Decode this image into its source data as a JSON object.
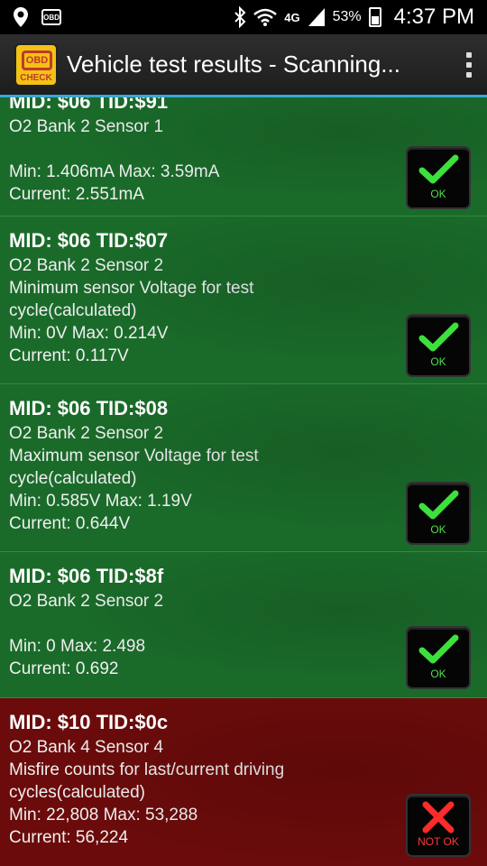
{
  "status_bar": {
    "icons": [
      "location-pin-icon",
      "obd-icon",
      "bluetooth-icon",
      "wifi-icon",
      "signal-icon",
      "battery-icon"
    ],
    "network": "4G",
    "battery": "53%",
    "time": "4:37 PM"
  },
  "action_bar": {
    "logo_text": "OBD",
    "logo_sub": "CHECK",
    "title": "Vehicle test results - Scanning..."
  },
  "colors": {
    "pass_bg": "#1a6b2a",
    "fail_bg": "#6b0b0b",
    "accent": "#3aa7d6",
    "ok_green": "#4ee04e",
    "fail_red": "#ff3a3a"
  },
  "results": [
    {
      "mid": "MID: $06 TID:$91",
      "sensor": "O2 Bank 2 Sensor 1",
      "description": "",
      "min_max": "Min: 1.406mA  Max: 3.59mA",
      "current": "Current: 2.551mA",
      "status": "OK"
    },
    {
      "mid": "MID: $06 TID:$07",
      "sensor": "O2 Bank 2 Sensor 2",
      "description": "Minimum sensor Voltage for test cycle(calculated)",
      "min_max": "Min: 0V  Max: 0.214V",
      "current": "Current: 0.117V",
      "status": "OK"
    },
    {
      "mid": "MID: $06 TID:$08",
      "sensor": "O2 Bank 2 Sensor 2",
      "description": "Maximum sensor Voltage for test cycle(calculated)",
      "min_max": "Min: 0.585V  Max: 1.19V",
      "current": "Current: 0.644V",
      "status": "OK"
    },
    {
      "mid": "MID: $06 TID:$8f",
      "sensor": "O2 Bank 2 Sensor 2",
      "description": "",
      "min_max": "Min: 0  Max: 2.498",
      "current": "Current: 0.692",
      "status": "OK"
    },
    {
      "mid": "MID: $10 TID:$0c",
      "sensor": "O2 Bank 4 Sensor 4",
      "description": "Misfire counts for last/current driving cycles(calculated)",
      "min_max": "Min: 22,808  Max: 53,288",
      "current": "Current: 56,224",
      "status": "NOT OK"
    }
  ]
}
